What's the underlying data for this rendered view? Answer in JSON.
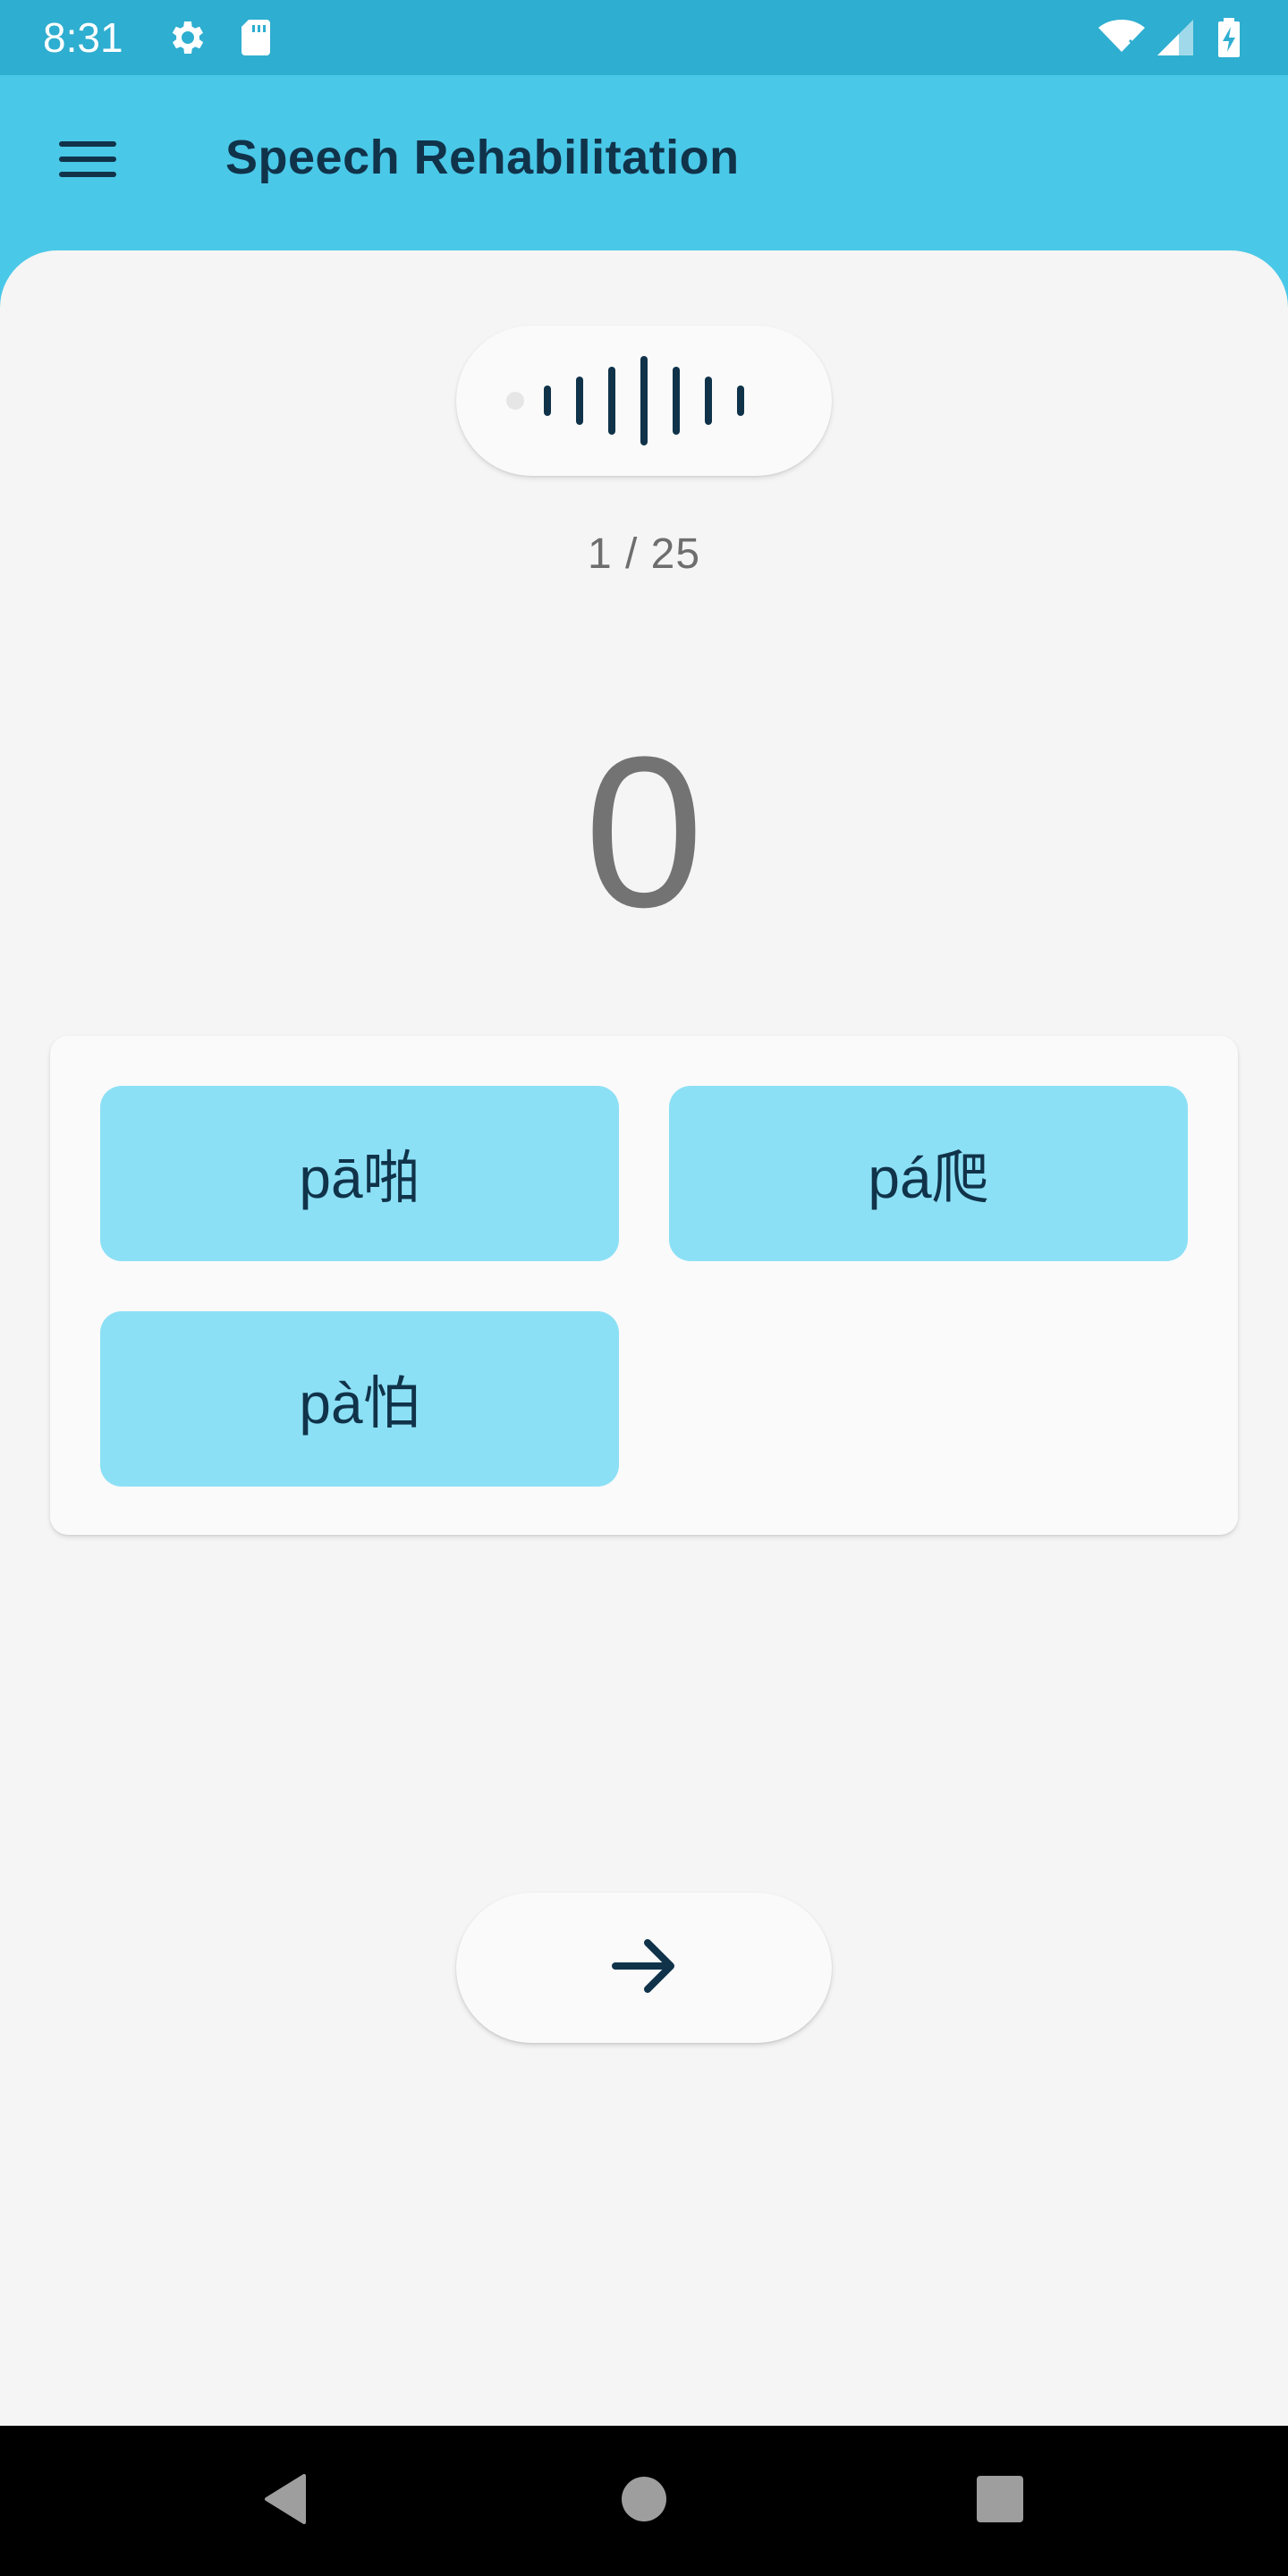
{
  "status_bar": {
    "time": "8:31",
    "icons": [
      "settings-icon",
      "sd-card-icon",
      "wifi-icon",
      "cell-signal-icon",
      "battery-charging-icon"
    ]
  },
  "app_bar": {
    "menu_icon": "menu-icon",
    "title": "Speech Rehabilitation"
  },
  "player": {
    "icon": "audio-waveform-icon"
  },
  "progress": {
    "text": "1 / 25"
  },
  "score": {
    "value": "0"
  },
  "options": [
    {
      "label": "pā啪"
    },
    {
      "label": "pá爬"
    },
    {
      "label": "pà怕"
    }
  ],
  "next_button": {
    "icon": "arrow-right-icon"
  },
  "nav_bar": {
    "icons": [
      "back-icon",
      "home-icon",
      "recents-icon"
    ]
  },
  "colors": {
    "status_bar": "#2eaed0",
    "app_bar": "#4ac8e8",
    "sheet": "#f5f5f5",
    "option": "#8ce0f5",
    "primary_text": "#10334a"
  }
}
